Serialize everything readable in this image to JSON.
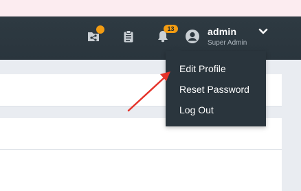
{
  "colors": {
    "navbar": "#2b363e",
    "badge": "#f39c12",
    "arrow": "#e5332a",
    "page_bg": "#e9ecf1"
  },
  "navbar": {
    "icons": [
      {
        "name": "share-folder-icon"
      },
      {
        "name": "clipboard-icon"
      },
      {
        "name": "bell-icon"
      }
    ],
    "notifications_count": "13",
    "user": {
      "name": "admin",
      "role": "Super Admin",
      "avatar_icon": "user-circle-icon",
      "dropdown_icon": "chevron-down-icon"
    }
  },
  "user_menu": {
    "items": [
      {
        "label": "Edit Profile"
      },
      {
        "label": "Reset Password"
      },
      {
        "label": "Log Out"
      }
    ]
  },
  "annotation": {
    "type": "red-arrow",
    "points_to": "Edit Profile"
  }
}
